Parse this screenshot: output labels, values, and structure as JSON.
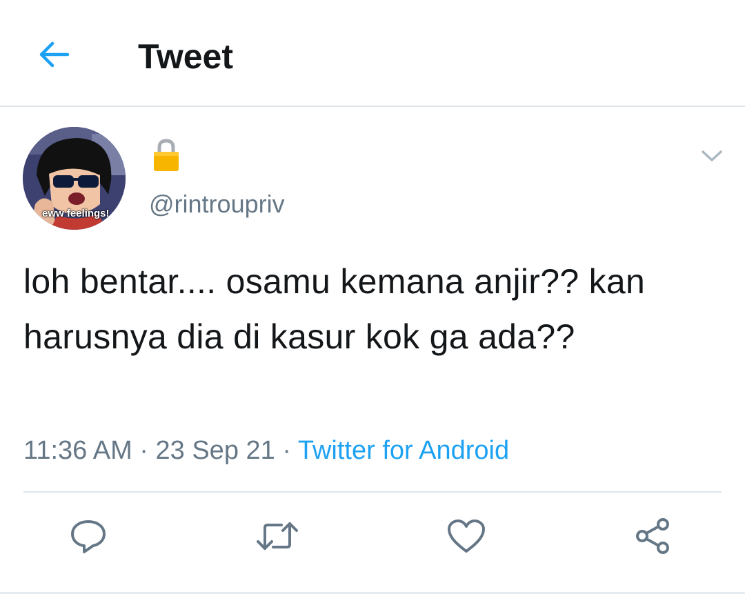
{
  "header": {
    "title": "Tweet",
    "back_icon": "arrow-left-icon"
  },
  "author": {
    "display_name_icon": "lock-icon",
    "handle": "@rintroupriv",
    "avatar_caption": "eww feelings!"
  },
  "tweet": {
    "text": "loh bentar.... osamu kemana anjir?? kan harusnya dia di kasur kok ga ada??",
    "time": "11:36 AM",
    "date": "23 Sep 21",
    "separator": "·",
    "source": "Twitter for Android"
  },
  "actions": {
    "reply_icon": "reply-icon",
    "retweet_icon": "retweet-icon",
    "like_icon": "heart-icon",
    "share_icon": "share-icon"
  },
  "colors": {
    "accent": "#1da1f2",
    "text": "#14171a",
    "secondary": "#657786",
    "border": "#dfe5e9",
    "lock": "#f7b500"
  }
}
